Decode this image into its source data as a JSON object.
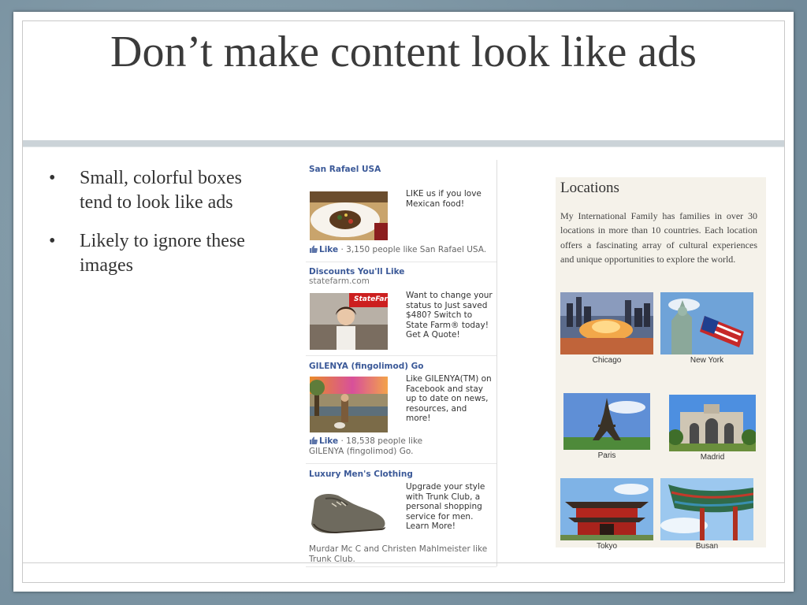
{
  "title": "Don’t make content look like ads",
  "bullets": [
    {
      "marker": "•",
      "text": "Small, colorful boxes tend to look like ads"
    },
    {
      "marker": "•",
      "text": "Likely to ignore these images"
    }
  ],
  "ads": [
    {
      "title": "San Rafael USA",
      "domain": "",
      "text": "LIKE us if you love Mexican food!",
      "like_label": "Like",
      "like_text": " · 3,150 people like San Rafael USA."
    },
    {
      "title": "Discounts You'll Like",
      "domain": "statefarm.com",
      "text": "Want to change your status to Just saved $480? Switch to State Farm® today! Get A Quote!",
      "logo_text": "StateFarm"
    },
    {
      "title": "GILENYA (fingolimod) Go",
      "domain": "",
      "text": "Like GILENYA(TM) on Facebook and stay up to date on news, resources, and more!",
      "like_label": "Like",
      "like_text": " · 18,538 people like GILENYA (fingolimod) Go."
    },
    {
      "title": "Luxury Men's Clothing",
      "domain": "",
      "text": "Upgrade your style with Trunk Club, a personal shopping service for men. Learn More!",
      "social_text": "Murdar Mc C and Christen Mahlmeister like Trunk Club."
    }
  ],
  "locations": {
    "heading": "Locations",
    "description": "My International Family has families in over 30 locations in more than 10 countries. Each location offers a fascinating array of cultural experiences and unique opportunities to explore the world.",
    "cities": [
      "Chicago",
      "New York",
      "Paris",
      "Madrid",
      "Tokyo",
      "Busan"
    ]
  },
  "colors": {
    "fb_link": "#3b5998",
    "title_text": "#3b3b3b",
    "background": "#7d96a3"
  },
  "icons": [
    "thumbs-up-icon"
  ]
}
